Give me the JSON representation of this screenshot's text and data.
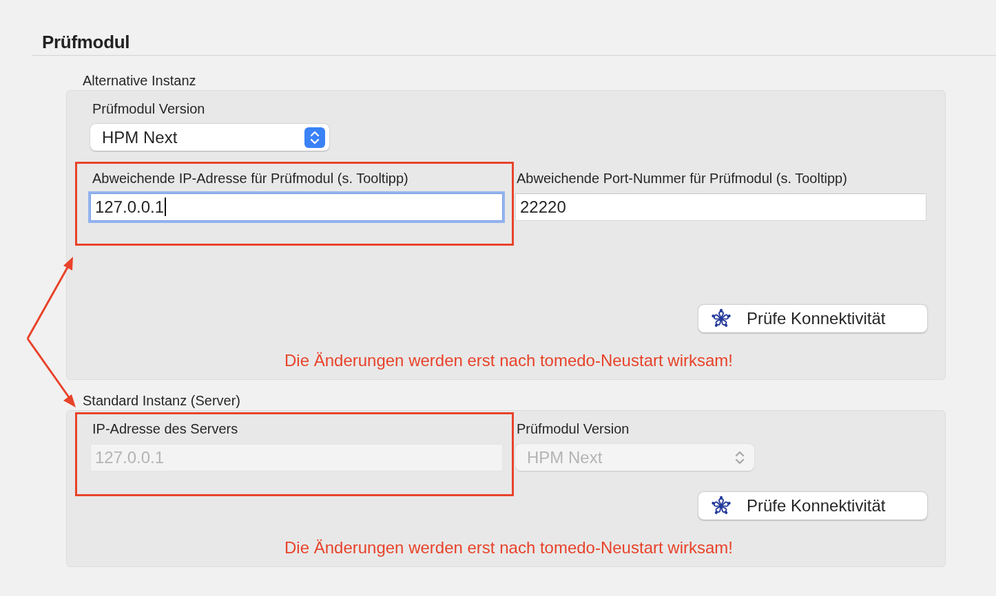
{
  "section_title": "Prüfmodul",
  "groups": [
    {
      "title": "Alternative Instanz",
      "rows": [
        [
          {
            "kind": "popup",
            "label": "Prüfmodul Version",
            "value": "HPM Next",
            "disabled": false,
            "annotated": false
          }
        ],
        [
          {
            "kind": "text",
            "label": "Abweichende IP-Adresse für Prüfmodul (s. Tooltipp)",
            "value": "127.0.0.1",
            "focused": true,
            "disabled": false,
            "annotated": true
          },
          {
            "kind": "text",
            "label": "Abweichende Port-Nummer für Prüfmodul (s. Tooltipp)",
            "value": "22220",
            "focused": false,
            "disabled": false,
            "annotated": false
          }
        ]
      ],
      "button": "Prüfe Konnektivität",
      "notice": "Die Änderungen werden erst nach tomedo-Neustart wirksam!"
    },
    {
      "title": "Standard Instanz (Server)",
      "rows": [
        [
          {
            "kind": "text",
            "label": "IP-Adresse des Servers",
            "value": "127.0.0.1",
            "focused": false,
            "disabled": true,
            "annotated": true
          },
          {
            "kind": "popup",
            "label": "Prüfmodul Version",
            "value": "HPM Next",
            "disabled": true,
            "annotated": false
          }
        ]
      ],
      "button": "Prüfe Konnektivität",
      "notice": "Die Änderungen werden erst nach tomedo-Neustart wirksam!"
    }
  ]
}
